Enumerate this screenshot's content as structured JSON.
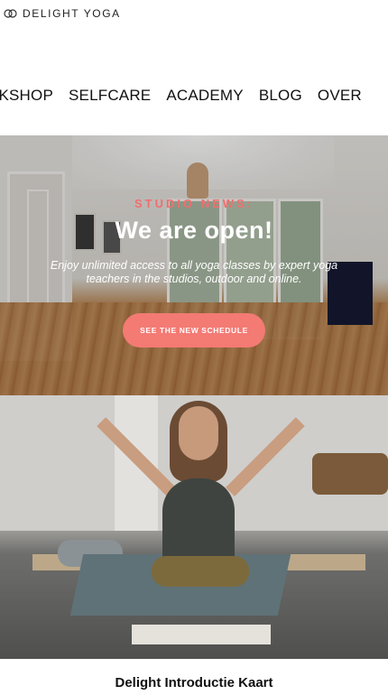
{
  "header": {
    "logo": {
      "icon": "logo-rings-icon",
      "text": "DELIGHT YOGA"
    },
    "nav": [
      "RKSHOP",
      "SELFCARE",
      "ACADEMY",
      "BLOG",
      "OVER"
    ]
  },
  "hero": {
    "kicker": "STUDIO NEWS:",
    "title": "We are open!",
    "text": "Enjoy unlimited access to all yoga classes by expert yoga teachers in the studios, outdoor and online.",
    "button": "SEE THE NEW SCHEDULE",
    "accent_color": "#f47a74"
  },
  "card": {
    "title": "Delight Introductie Kaart"
  }
}
